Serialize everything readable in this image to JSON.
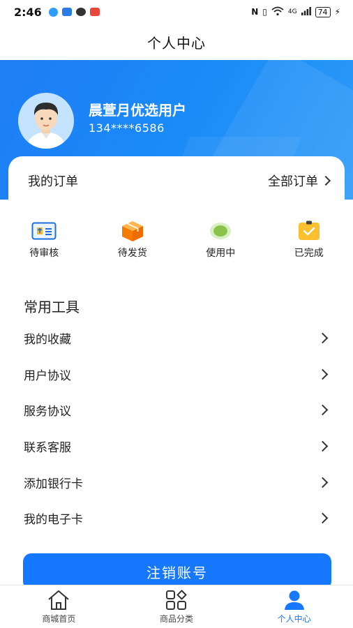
{
  "status_bar": {
    "time": "2:46",
    "network": "4G",
    "battery": "74"
  },
  "nav": {
    "title": "个人中心"
  },
  "user": {
    "name": "晨萱月优选用户",
    "phone": "134****6586"
  },
  "orders": {
    "title": "我的订单",
    "all_label": "全部订单",
    "items": [
      {
        "label": "待审核",
        "icon": "pending-review-icon"
      },
      {
        "label": "待发货",
        "icon": "package-icon"
      },
      {
        "label": "使用中",
        "icon": "in-use-icon"
      },
      {
        "label": "已完成",
        "icon": "completed-icon"
      }
    ]
  },
  "tools": {
    "title": "常用工具",
    "items": [
      {
        "label": "我的收藏"
      },
      {
        "label": "用户协议"
      },
      {
        "label": "服务协议"
      },
      {
        "label": "联系客服"
      },
      {
        "label": "添加银行卡"
      },
      {
        "label": "我的电子卡"
      }
    ]
  },
  "logout": {
    "label": "注销账号"
  },
  "tab_bar": {
    "tabs": [
      {
        "label": "商城首页",
        "icon": "home-icon",
        "active": false
      },
      {
        "label": "商品分类",
        "icon": "category-icon",
        "active": false
      },
      {
        "label": "个人中心",
        "icon": "user-icon",
        "active": true
      }
    ]
  },
  "colors": {
    "primary": "#1677ff",
    "header_gradient_start": "#1f7df5",
    "header_gradient_end": "#2f9cf9"
  }
}
